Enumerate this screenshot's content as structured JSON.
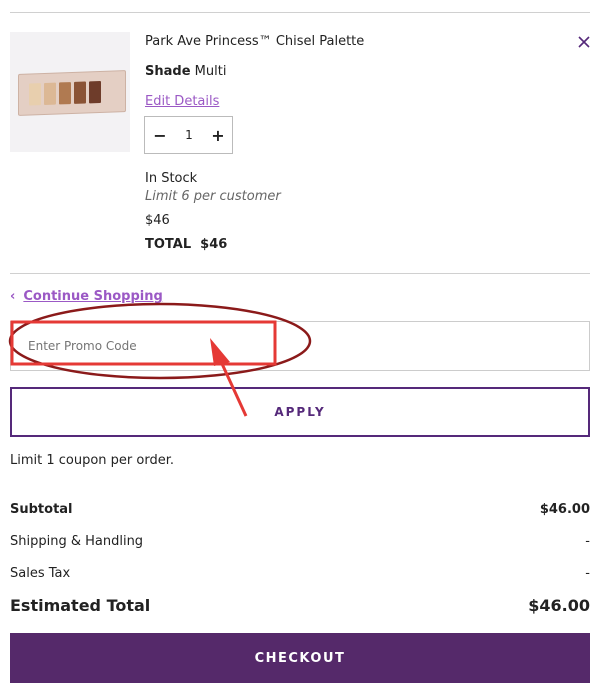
{
  "product": {
    "name": "Park Ave Princess™ Chisel Palette",
    "shade_label": "Shade",
    "shade_value": "Multi",
    "edit_link": "Edit Details",
    "quantity": "1",
    "stock": "In Stock",
    "limit": "Limit 6 per customer",
    "price": "$46",
    "total": "TOTAL  $46",
    "pan_colors": [
      "#e8cfae",
      "#dcb895",
      "#b07a51",
      "#8a5335",
      "#6e3c2a"
    ]
  },
  "nav": {
    "continue_label": "Continue Shopping"
  },
  "promo": {
    "placeholder": "Enter Promo Code",
    "apply_label": "APPLY",
    "coupon_note": "Limit 1 coupon per order."
  },
  "summary": {
    "subtotal_label": "Subtotal",
    "subtotal_value": "$46.00",
    "shipping_label": "Shipping & Handling",
    "shipping_value": "-",
    "tax_label": "Sales Tax",
    "tax_value": "-",
    "estimated_label": "Estimated Total",
    "estimated_value": "$46.00"
  },
  "checkout": {
    "label": "CHECKOUT"
  },
  "colors": {
    "brand_purple": "#55296a",
    "link_purple": "#9b59c5",
    "annotation_red": "#e53935",
    "annotation_dark_red": "#8b1a1a"
  }
}
